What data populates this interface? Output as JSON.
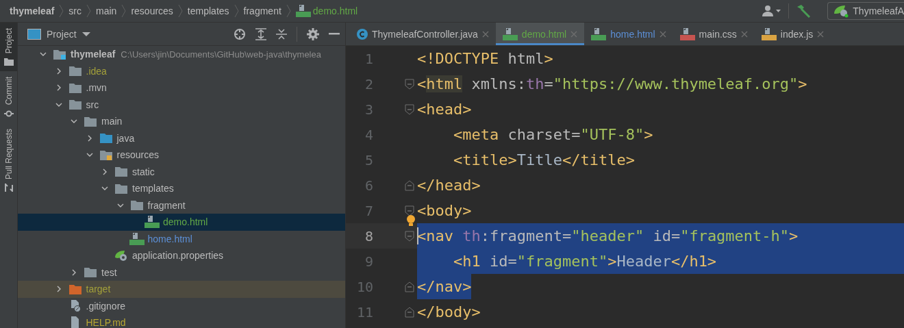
{
  "breadcrumbs": [
    {
      "label": "thymeleaf",
      "kind": "project"
    },
    {
      "label": "src",
      "kind": "folder"
    },
    {
      "label": "main",
      "kind": "folder"
    },
    {
      "label": "resources",
      "kind": "folder"
    },
    {
      "label": "templates",
      "kind": "folder"
    },
    {
      "label": "fragment",
      "kind": "folder"
    },
    {
      "label": "demo.html",
      "kind": "html"
    }
  ],
  "toolbar": {
    "run_config": "ThymeleafA"
  },
  "side_tabs": [
    {
      "label": "Project",
      "selected": true
    },
    {
      "label": "Commit",
      "selected": false
    },
    {
      "label": "Pull Requests",
      "selected": false
    }
  ],
  "project_panel": {
    "title": "Project",
    "tree": [
      {
        "name": "thymeleaf",
        "kind": "module",
        "path": "C:\\Users\\jin\\Documents\\GitHub\\web-java\\thymelea",
        "expanded": true,
        "selected": false,
        "color": "#bbbbbb",
        "children": [
          {
            "name": ".idea",
            "kind": "folder",
            "expanded": false,
            "selected": false,
            "color": "#a3a03a"
          },
          {
            "name": ".mvn",
            "kind": "folder",
            "expanded": false,
            "selected": false,
            "color": "#bbbbbb"
          },
          {
            "name": "src",
            "kind": "folder",
            "expanded": true,
            "selected": false,
            "color": "#bbbbbb",
            "children": [
              {
                "name": "main",
                "kind": "folder",
                "expanded": true,
                "selected": false,
                "color": "#bbbbbb",
                "children": [
                  {
                    "name": "java",
                    "kind": "source-folder",
                    "expanded": false,
                    "selected": false,
                    "color": "#bbbbbb"
                  },
                  {
                    "name": "resources",
                    "kind": "resource-folder",
                    "expanded": true,
                    "selected": false,
                    "color": "#bbbbbb",
                    "children": [
                      {
                        "name": "static",
                        "kind": "folder",
                        "expanded": false,
                        "selected": false,
                        "color": "#bbbbbb"
                      },
                      {
                        "name": "templates",
                        "kind": "folder",
                        "expanded": true,
                        "selected": false,
                        "color": "#bbbbbb",
                        "children": [
                          {
                            "name": "fragment",
                            "kind": "folder",
                            "expanded": true,
                            "selected": false,
                            "color": "#bbbbbb",
                            "children": [
                              {
                                "name": "demo.html",
                                "kind": "html",
                                "selected": true,
                                "color": "#62a846"
                              }
                            ]
                          },
                          {
                            "name": "home.html",
                            "kind": "html",
                            "selected": false,
                            "color": "#5c8fd6"
                          }
                        ]
                      },
                      {
                        "name": "application.properties",
                        "kind": "properties",
                        "selected": false,
                        "color": "#bbbbbb"
                      }
                    ]
                  }
                ]
              },
              {
                "name": "test",
                "kind": "folder",
                "expanded": false,
                "selected": false,
                "color": "#bbbbbb"
              }
            ]
          },
          {
            "name": "target",
            "kind": "excluded-folder",
            "expanded": false,
            "selected": false,
            "color": "#a3a03a"
          },
          {
            "name": ".gitignore",
            "kind": "ignore",
            "selected": false,
            "color": "#bbbbbb"
          },
          {
            "name": "HELP.md",
            "kind": "markdown",
            "selected": false,
            "color": "#b8a732"
          }
        ]
      }
    ]
  },
  "editor": {
    "tabs": [
      {
        "label": "ThymeleafController.java",
        "kind": "class",
        "selected": false,
        "color": "#bbbbbb"
      },
      {
        "label": "demo.html",
        "kind": "html",
        "selected": true,
        "color": "#62a846"
      },
      {
        "label": "home.html",
        "kind": "html",
        "selected": false,
        "color": "#5c8fd6"
      },
      {
        "label": "main.css",
        "kind": "css",
        "selected": false,
        "color": "#bbbbbb"
      },
      {
        "label": "index.js",
        "kind": "js",
        "selected": false,
        "color": "#bbbbbb"
      }
    ],
    "lines": [
      {
        "number": "1",
        "segments": [
          {
            "text": "<!DOCTYPE",
            "kind": "tag"
          },
          {
            "text": " html",
            "kind": "attr"
          },
          {
            "text": ">",
            "kind": "tag"
          }
        ]
      },
      {
        "number": "2",
        "fold_start": true,
        "segments": [
          {
            "text": "<",
            "kind": "tag"
          },
          {
            "text": "html",
            "kind": "tag",
            "highlight": true
          },
          {
            "text": " xmlns:",
            "kind": "attr"
          },
          {
            "text": "th",
            "kind": "ns"
          },
          {
            "text": "=",
            "kind": "attr"
          },
          {
            "text": "\"https://www.thymeleaf.org\"",
            "kind": "value"
          },
          {
            "text": ">",
            "kind": "tag"
          }
        ]
      },
      {
        "number": "3",
        "fold_start": true,
        "segments": [
          {
            "text": "<head>",
            "kind": "tag"
          }
        ]
      },
      {
        "number": "4",
        "segments": [
          {
            "text": "    <meta",
            "kind": "tag"
          },
          {
            "text": " charset=",
            "kind": "attr"
          },
          {
            "text": "\"UTF-8\"",
            "kind": "value"
          },
          {
            "text": ">",
            "kind": "tag"
          }
        ]
      },
      {
        "number": "5",
        "segments": [
          {
            "text": "    <title>",
            "kind": "tag"
          },
          {
            "text": "Title",
            "kind": "text"
          },
          {
            "text": "</title>",
            "kind": "tag"
          }
        ]
      },
      {
        "number": "6",
        "fold_end": true,
        "segments": [
          {
            "text": "</head>",
            "kind": "tag"
          }
        ]
      },
      {
        "number": "7",
        "fold_start": true,
        "intention_bulb": true,
        "segments": [
          {
            "text": "<body>",
            "kind": "tag"
          }
        ]
      },
      {
        "number": "8",
        "fold_start": true,
        "current": true,
        "caret": true,
        "selected": true,
        "selection_to_edge": true,
        "segments": [
          {
            "text": "<nav ",
            "kind": "tag"
          },
          {
            "text": "th",
            "kind": "ns"
          },
          {
            "text": ":fragment=",
            "kind": "attr"
          },
          {
            "text": "\"header\"",
            "kind": "value"
          },
          {
            "text": " id=",
            "kind": "attr"
          },
          {
            "text": "\"fragment-h\"",
            "kind": "value"
          },
          {
            "text": ">",
            "kind": "tag"
          }
        ]
      },
      {
        "number": "9",
        "selected": true,
        "selection_to_edge": true,
        "segments": [
          {
            "text": "    <h1",
            "kind": "tag"
          },
          {
            "text": " id=",
            "kind": "attr"
          },
          {
            "text": "\"fragment\"",
            "kind": "value"
          },
          {
            "text": ">",
            "kind": "tag"
          },
          {
            "text": "Header",
            "kind": "text"
          },
          {
            "text": "</h1>",
            "kind": "tag"
          }
        ]
      },
      {
        "number": "10",
        "fold_end": true,
        "selected": true,
        "segments": [
          {
            "text": "</nav>",
            "kind": "tag"
          }
        ]
      },
      {
        "number": "11",
        "fold_end": true,
        "segments": [
          {
            "text": "</body>",
            "kind": "tag"
          }
        ]
      }
    ]
  }
}
